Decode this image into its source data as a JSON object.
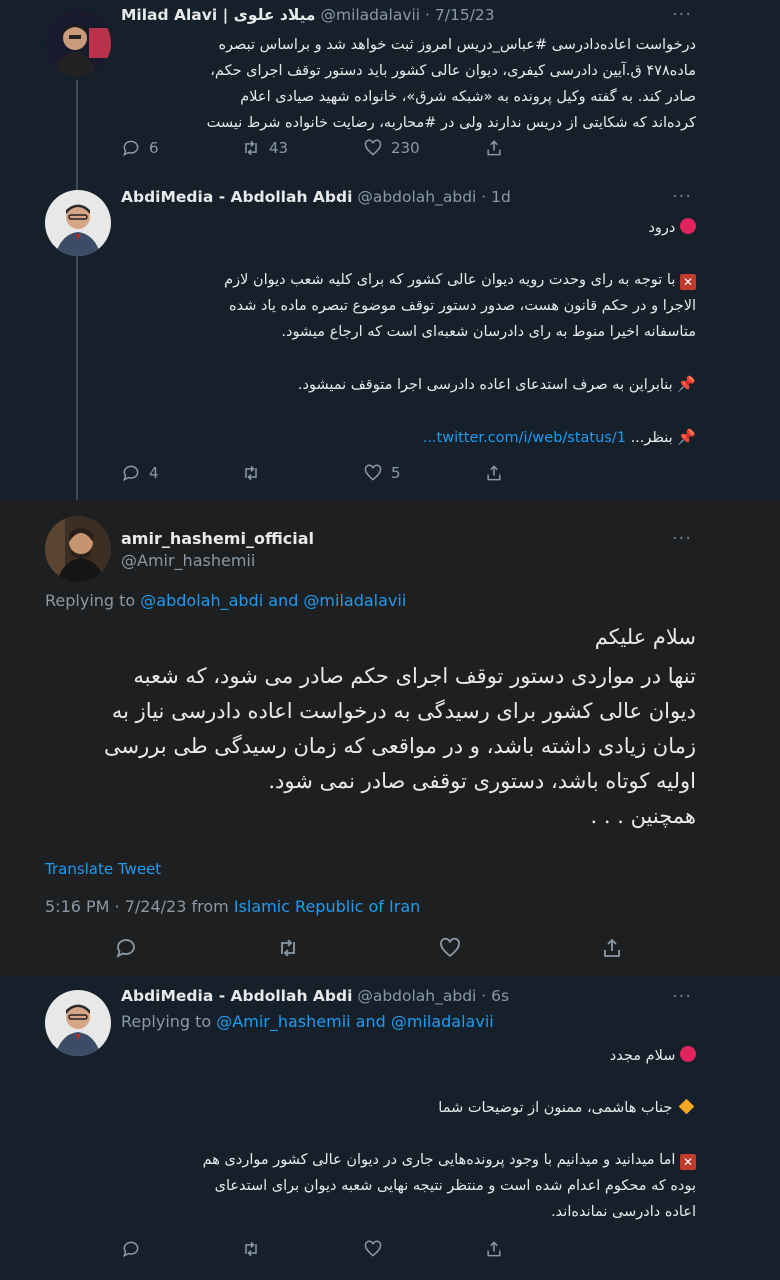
{
  "tweet1": {
    "display_name": "Milad Alavi | میلاد علوی",
    "handle": "@miladalavii",
    "date": "· 7/15/23",
    "more": "···",
    "lines": [
      "درخواست اعاده‌دادرسی #عباس_دریس امروز ثبت خواهد شد و براساس تبصره",
      "ماده۴۷۸ ق.آیین دادرسی کیفری، دیوان عالی کشور باید دستور توقف اجرای حکم،",
      "صادر کند. به گفته وکیل پرونده به «شبکه شرق»، خانواده شهید صیادی اعلام",
      "کرده‌اند که شکایتی از دریس ندارند ولی در #محاربه، رضایت خانواده شرط نیست"
    ],
    "replies": "6",
    "retweets": "43",
    "likes": "230"
  },
  "tweet2": {
    "display_name": "AbdiMedia - Abdollah Abdi",
    "handle": "@abdolah_abdi",
    "date": "· 1d",
    "more": "···",
    "greeting": "درود",
    "para1": [
      "با توجه به رای وحدت رویه دیوان عالی کشور که برای کلیه شعب دیوان لازم",
      "الاجرا و در حکم قانون هست، صدور دستور توقف موضوع تبصره ماده یاد شده",
      "متاسفانه اخیرا منوط به رای دادرسان شعبه‌ای است که ارجاع میشود."
    ],
    "para2": "بنابراین به صرف استدعای اعاده دادرسی اجرا متوقف نمیشود.",
    "para3_text": "بنظر...",
    "para3_link": "twitter.com/i/web/status/1...",
    "replies": "4",
    "retweets": "",
    "likes": "5"
  },
  "tweet3": {
    "display_name": "amir_hashemi_official",
    "handle": "@Amir_hashemii",
    "more": "···",
    "replying_prefix": "Replying to",
    "replying_users": "@abdolah_abdi and @miladalavii",
    "lines": [
      "سلام علیکم",
      "تنها در مواردی دستور توقف اجرای حکم صادر می شود، که شعبه",
      "دیوان عالی کشور برای رسیدگی به درخواست اعاده دادرسی نیاز به",
      "زمان زیادی داشته باشد، و در مواقعی که زمان رسیدگی طی بررسی",
      "اولیه کوتاه باشد، دستوری توقفی صادر نمی شود.",
      "همچنین . . ."
    ],
    "translate": "Translate Tweet",
    "timestamp": "5:16 PM · 7/24/23 from",
    "location": "Islamic Republic of Iran"
  },
  "tweet4": {
    "display_name": "AbdiMedia - Abdollah Abdi",
    "handle": "@abdolah_abdi",
    "date": "· 6s",
    "more": "···",
    "replying_prefix": "Replying to",
    "replying_users": "@Amir_hashemii and @miladalavii",
    "greeting": "سلام مجدد",
    "line2": "جناب هاشمی، ممنون از توضیحات شما",
    "para": [
      "اما میدانید و میدانیم با وجود پرونده‌هایی جاری در دیوان عالی کشور مواردی هم",
      "بوده که محکوم اعدام شده است و منتظر نتیجه نهایی شعبه دیوان  برای استدعای",
      "اعاده دادرسی نمانده‌اند."
    ]
  },
  "colors": {
    "background": "#15202b",
    "highlight_background": "#1e1f20",
    "accent_link": "#1d9bf0",
    "secondary_text": "#8b98a5"
  }
}
